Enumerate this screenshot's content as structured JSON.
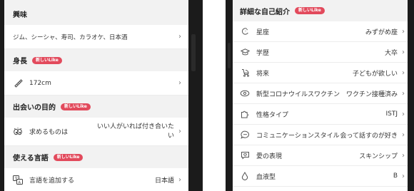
{
  "left": {
    "interests": {
      "title": "興味",
      "value": "ジム、シーシャ、寿司、カラオケ、日本酒"
    },
    "height": {
      "title": "身長",
      "badge": "新しいLike",
      "value": "172cm"
    },
    "purpose": {
      "title": "出会いの目的",
      "badge": "新しいLike",
      "label": "求めるものは",
      "value_line1": "いい人がいれば付き合いた",
      "value_line2": "い"
    },
    "languages": {
      "title": "使える言語",
      "badge": "新しいLike",
      "label": "言語を追加する",
      "value": "日本語"
    }
  },
  "right": {
    "header": {
      "title": "詳細な自己紹介",
      "badge": "新しいLike"
    },
    "rows": [
      {
        "icon": "zodiac-icon",
        "label": "星座",
        "value": "みずがめ座"
      },
      {
        "icon": "graduation-cap-icon",
        "label": "学歴",
        "value": "大卒"
      },
      {
        "icon": "stroller-icon",
        "label": "将来",
        "value": "子どもが欲しい"
      },
      {
        "icon": "vaccine-icon",
        "label": "新型コロナウイルスワクチン",
        "value": "ワクチン接種済み"
      },
      {
        "icon": "puzzle-icon",
        "label": "性格タイプ",
        "value": "ISTJ"
      },
      {
        "icon": "chat-bubble-icon",
        "label": "コミュニケーションスタイル",
        "value": "会って話すのが好き"
      },
      {
        "icon": "heart-message-icon",
        "label": "愛の表現",
        "value": "スキンシップ"
      },
      {
        "icon": "blood-drop-icon",
        "label": "血液型",
        "value": "B"
      }
    ]
  },
  "chevron": "›",
  "colors": {
    "badge": "#e24a5c",
    "section_bg": "#f2f2f2",
    "bezel": "#1b1b1b"
  }
}
